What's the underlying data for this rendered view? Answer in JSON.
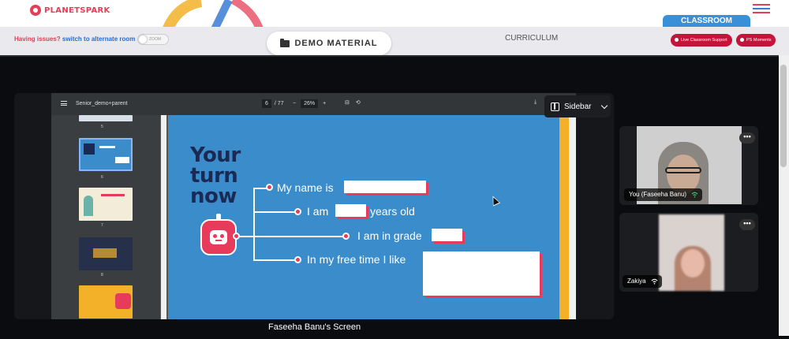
{
  "header": {
    "logo_text": "PLANETSPARK",
    "classroom_tab": "CLASSROOM"
  },
  "subbar": {
    "issue_question": "Having issues?",
    "issue_link": "switch to alternate room",
    "zoom_toggle": "ZOOM",
    "demo_material": "DEMO MATERIAL",
    "curriculum": "CURRICULUM",
    "live_support": "Live Classroom Support",
    "ps_moments": "PS Moments"
  },
  "pdf_viewer": {
    "document_name": "Senior_demo+parent",
    "current_page": "6",
    "total_pages": "/ 77",
    "zoom_minus": "−",
    "zoom": "26%",
    "zoom_plus": "+",
    "thumbnails": [
      {
        "label": "5"
      },
      {
        "label": "6"
      },
      {
        "label": "7"
      },
      {
        "label": "8"
      }
    ]
  },
  "slide": {
    "title_line1": "Your",
    "title_line2": "turn",
    "title_line3": "now",
    "prompts": [
      "My name is",
      "I am",
      "years old",
      "I am in grade",
      "In my free time I like"
    ]
  },
  "sidebar_control": {
    "label": "Sidebar"
  },
  "share": {
    "caption": "Faseeha Banu's Screen"
  },
  "participants": [
    {
      "name": "You (Faseeha Banu)",
      "more": "•••"
    },
    {
      "name": "Zakiya",
      "more": "•••"
    }
  ],
  "colors": {
    "brand_red": "#e53e57",
    "classroom_blue": "#3a8fd9",
    "slide_blue": "#3a8ccb",
    "accent_pink": "#e83a5a",
    "title_navy": "#1a2a55"
  }
}
